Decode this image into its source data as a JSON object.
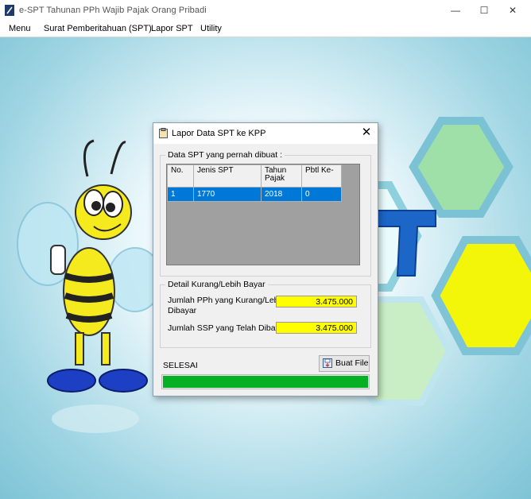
{
  "window": {
    "title": "e-SPT Tahunan PPh Wajib Pajak Orang Pribadi",
    "controls": {
      "minimize": "—",
      "maximize": "☐",
      "close": "✕"
    }
  },
  "menu": {
    "items": [
      "Menu",
      "Surat Pemberitahuan (SPT)",
      "Lapor SPT",
      "Utility"
    ]
  },
  "dialog": {
    "title": "Lapor Data SPT ke KPP",
    "close_glyph": "✕",
    "spt_group": {
      "legend": "Data SPT yang pernah dibuat :",
      "columns": [
        "No.",
        "Jenis SPT",
        "Tahun Pajak",
        "Pbtl Ke-"
      ],
      "rows": [
        {
          "no": "1",
          "jenis": "1770",
          "tahun": "2018",
          "pbtl": "0"
        }
      ]
    },
    "detail_group": {
      "legend": "Detail Kurang/Lebih Bayar",
      "pph_label_line1": "Jumlah PPh yang Kurang/Lebih",
      "pph_label_line2": "Dibayar",
      "pph_value": "3.475.000",
      "ssp_label": "Jumlah SSP yang Telah Dibayar",
      "ssp_value": "3.475.000"
    },
    "buat_file_label": "Buat File",
    "status": "SELESAI",
    "progress": 1.0
  },
  "colors": {
    "progress_fill": "#06b025",
    "field_highlight": "#ffff00",
    "selection": "#0078d7"
  }
}
